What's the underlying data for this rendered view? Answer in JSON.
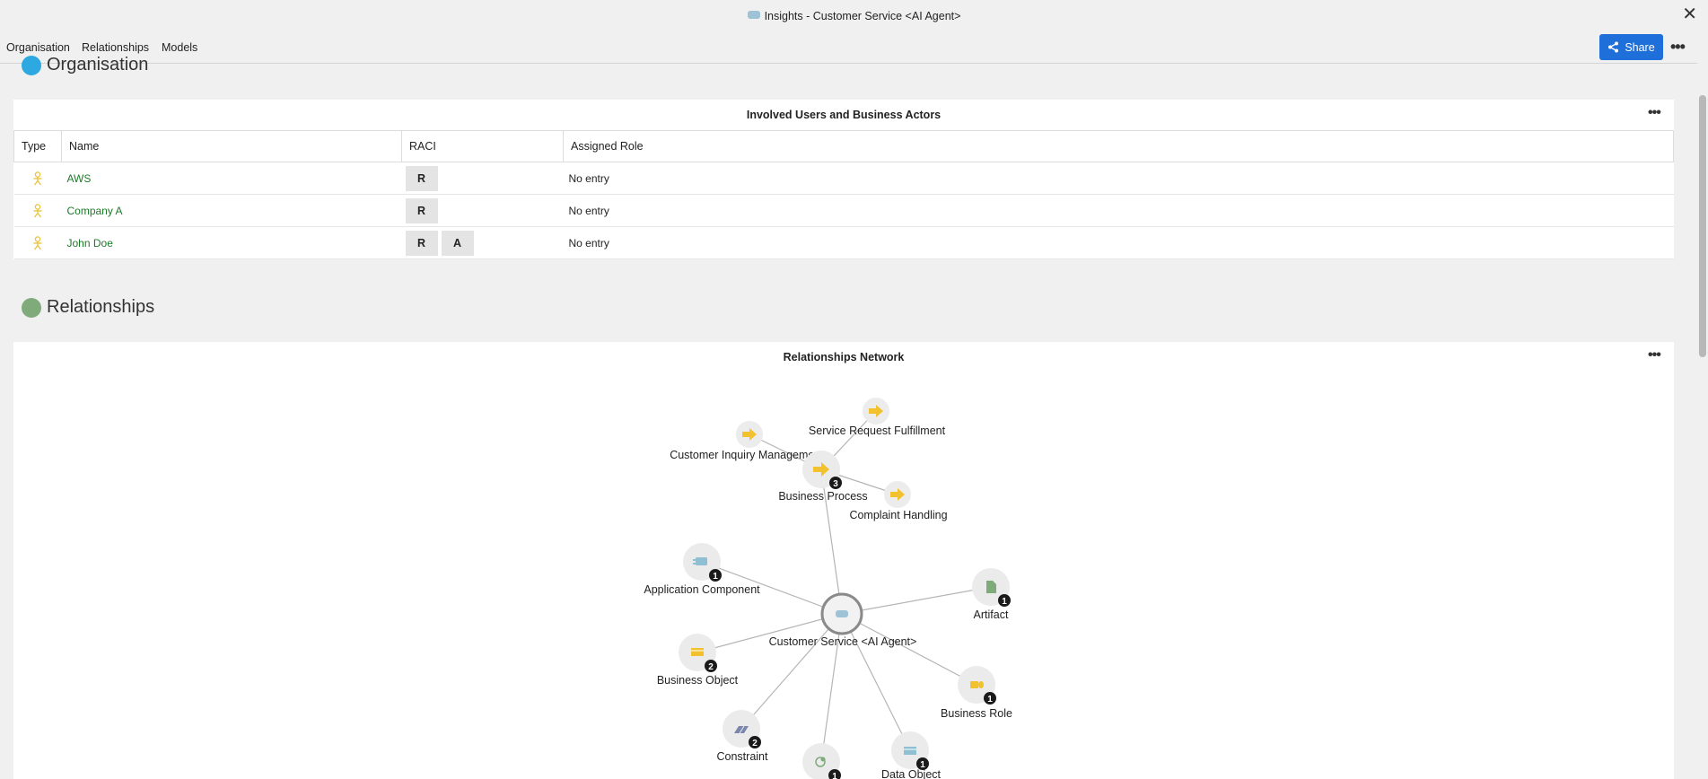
{
  "window": {
    "title": "Insights - Customer Service <AI Agent>",
    "close_glyph": "✕"
  },
  "nav": {
    "tabs": [
      "Organisation",
      "Relationships",
      "Models"
    ],
    "share_label": "Share",
    "more_glyph": "•••"
  },
  "organisation": {
    "heading": "Organisation",
    "dot_color": "#2ea8e0",
    "panel_title": "Involved Users and Business Actors",
    "columns": [
      "Type",
      "Name",
      "RACI",
      "Assigned Role"
    ],
    "rows": [
      {
        "type_icon": "business-actor-icon",
        "name": "AWS",
        "raci": [
          "R"
        ],
        "role": "No entry"
      },
      {
        "type_icon": "business-actor-icon",
        "name": "Company A",
        "raci": [
          "R"
        ],
        "role": "No entry"
      },
      {
        "type_icon": "business-actor-icon",
        "name": "John Doe",
        "raci": [
          "R",
          "A"
        ],
        "role": "No entry"
      }
    ]
  },
  "relationships": {
    "heading": "Relationships",
    "dot_color": "#7fab7a",
    "panel_title": "Relationships Network",
    "network": {
      "center": "Customer Service <AI Agent>",
      "groups": [
        {
          "label": "Business Process",
          "count": "3",
          "icon": "process-arrow-icon"
        },
        {
          "label": "Application Component",
          "count": "1",
          "icon": "application-component-icon"
        },
        {
          "label": "Artifact",
          "count": "1",
          "icon": "artifact-icon"
        },
        {
          "label": "Business Object",
          "count": "2",
          "icon": "business-object-icon"
        },
        {
          "label": "Business Role",
          "count": "1",
          "icon": "business-role-icon"
        },
        {
          "label": "Constraint",
          "count": "2",
          "icon": "constraint-icon"
        },
        {
          "label": "Data Object",
          "count": "1",
          "icon": "data-object-icon"
        },
        {
          "label": "",
          "count": "1",
          "icon": "goal-icon"
        }
      ],
      "processes": [
        "Service Request Fulfillment",
        "Customer Inquiry Management",
        "Complaint Handling"
      ]
    }
  },
  "colors": {
    "accent": "#1e6fd9",
    "link": "#1f7a2a",
    "actor_icon": "#e8c23a",
    "process_icon": "#f2c12e",
    "node_bg": "#ebebeb",
    "badge": "#1a1a1a"
  }
}
